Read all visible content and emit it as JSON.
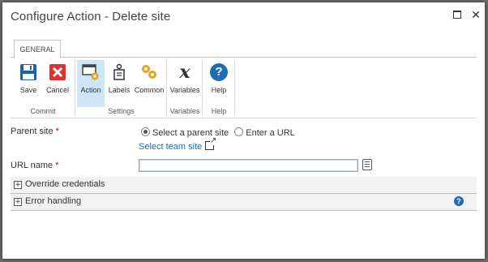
{
  "window": {
    "title": "Configure Action - Delete site",
    "maximize_icon": "maximize-icon",
    "close_glyph": "✕"
  },
  "ribbon": {
    "tab_label": "GENERAL",
    "groups": [
      {
        "label": "Commit",
        "buttons": [
          {
            "label": "Save",
            "icon": "save-icon",
            "color": "#1f5fae"
          },
          {
            "label": "Cancel",
            "icon": "cancel-icon",
            "color": "#e03030"
          }
        ]
      },
      {
        "label": "Settings",
        "buttons": [
          {
            "label": "Action",
            "icon": "action-gear-icon",
            "selected": true
          },
          {
            "label": "Labels",
            "icon": "labels-icon"
          },
          {
            "label": "Common",
            "icon": "common-gears-icon"
          }
        ]
      },
      {
        "label": "Variables",
        "buttons": [
          {
            "label": "Variables",
            "icon": "variable-x-icon",
            "glyph": "x"
          }
        ]
      },
      {
        "label": "Help",
        "buttons": [
          {
            "label": "Help",
            "icon": "help-icon",
            "glyph": "?"
          }
        ]
      }
    ]
  },
  "form": {
    "parent_site_label": "Parent site",
    "required_mark": "*",
    "radio_options": [
      {
        "label": "Select a parent site",
        "selected": true
      },
      {
        "label": "Enter a URL",
        "selected": false
      }
    ],
    "select_team_site_link": "Select team site",
    "url_name_label": "URL name",
    "url_name_value": ""
  },
  "sections": [
    {
      "title": "Override credentials",
      "expander": "+"
    },
    {
      "title": "Error handling",
      "expander": "+",
      "help_glyph": "?"
    }
  ],
  "colors": {
    "accent": "#1f6db5",
    "selected_button_bg": "#cde6f7",
    "section_bg": "#f1f1f1"
  }
}
